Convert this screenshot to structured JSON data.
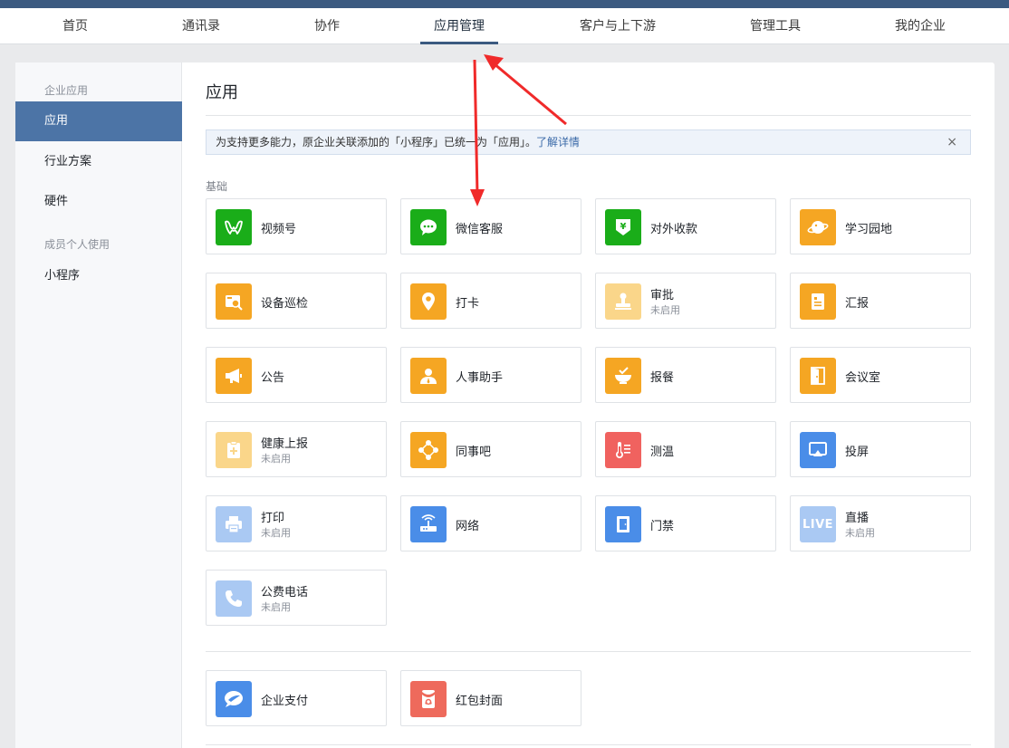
{
  "nav": {
    "tabs": [
      {
        "label": "首页"
      },
      {
        "label": "通讯录"
      },
      {
        "label": "协作"
      },
      {
        "label": "应用管理"
      },
      {
        "label": "客户与上下游"
      },
      {
        "label": "管理工具"
      },
      {
        "label": "我的企业"
      }
    ],
    "active": "应用管理"
  },
  "sidebar": {
    "group1": "企业应用",
    "items1": [
      {
        "label": "应用"
      },
      {
        "label": "行业方案"
      },
      {
        "label": "硬件"
      }
    ],
    "group2": "成员个人使用",
    "items2": [
      {
        "label": "小程序"
      }
    ]
  },
  "main": {
    "title": "应用",
    "notice": {
      "text": "为支持更多能力，原企业关联添加的「小程序」已统一为「应用」。",
      "link": "了解详情",
      "close": "×"
    },
    "section_label": "基础",
    "disabled_text": "未启用",
    "apps": [
      {
        "name": "视频号",
        "icon": "channels-icon",
        "color": "#1aad19",
        "disabled": false
      },
      {
        "name": "微信客服",
        "icon": "chat-bubble-icon",
        "color": "#1aad19",
        "disabled": false
      },
      {
        "name": "对外收款",
        "icon": "yuan-shield-icon",
        "color": "#1aad19",
        "disabled": false
      },
      {
        "name": "学习园地",
        "icon": "planet-icon",
        "color": "#f5a623",
        "disabled": false
      },
      {
        "name": "设备巡检",
        "icon": "device-inspect-icon",
        "color": "#f5a623",
        "disabled": false
      },
      {
        "name": "打卡",
        "icon": "location-pin-icon",
        "color": "#f5a623",
        "disabled": false
      },
      {
        "name": "审批",
        "icon": "stamp-icon",
        "color": "#fad68a",
        "disabled": true
      },
      {
        "name": "汇报",
        "icon": "report-doc-icon",
        "color": "#f5a623",
        "disabled": false
      },
      {
        "name": "公告",
        "icon": "megaphone-icon",
        "color": "#f5a623",
        "disabled": false
      },
      {
        "name": "人事助手",
        "icon": "person-icon",
        "color": "#f5a623",
        "disabled": false
      },
      {
        "name": "报餐",
        "icon": "meal-bowl-icon",
        "color": "#f5a623",
        "disabled": false
      },
      {
        "name": "会议室",
        "icon": "door-icon",
        "color": "#f5a623",
        "disabled": false
      },
      {
        "name": "健康上报",
        "icon": "health-clipboard-icon",
        "color": "#fad68a",
        "disabled": true
      },
      {
        "name": "同事吧",
        "icon": "network-nodes-icon",
        "color": "#f5a623",
        "disabled": false
      },
      {
        "name": "测温",
        "icon": "thermometer-icon",
        "color": "#f0625f",
        "disabled": false
      },
      {
        "name": "投屏",
        "icon": "screen-cast-icon",
        "color": "#4a8de8",
        "disabled": false
      },
      {
        "name": "打印",
        "icon": "printer-icon",
        "color": "#aac9f3",
        "disabled": true
      },
      {
        "name": "网络",
        "icon": "router-icon",
        "color": "#4a8de8",
        "disabled": false
      },
      {
        "name": "门禁",
        "icon": "access-door-icon",
        "color": "#4a8de8",
        "disabled": false
      },
      {
        "name": "直播",
        "icon": "live-icon",
        "color": "#aac9f3",
        "disabled": true,
        "glyph": "LIVE"
      },
      {
        "name": "公费电话",
        "icon": "phone-icon",
        "color": "#aac9f3",
        "disabled": true
      }
    ],
    "apps2": [
      {
        "name": "企业支付",
        "icon": "pay-bubble-icon",
        "color": "#4a8de8",
        "disabled": false
      },
      {
        "name": "红包封面",
        "icon": "red-packet-icon",
        "color": "#ee6a5c",
        "disabled": false
      }
    ]
  }
}
